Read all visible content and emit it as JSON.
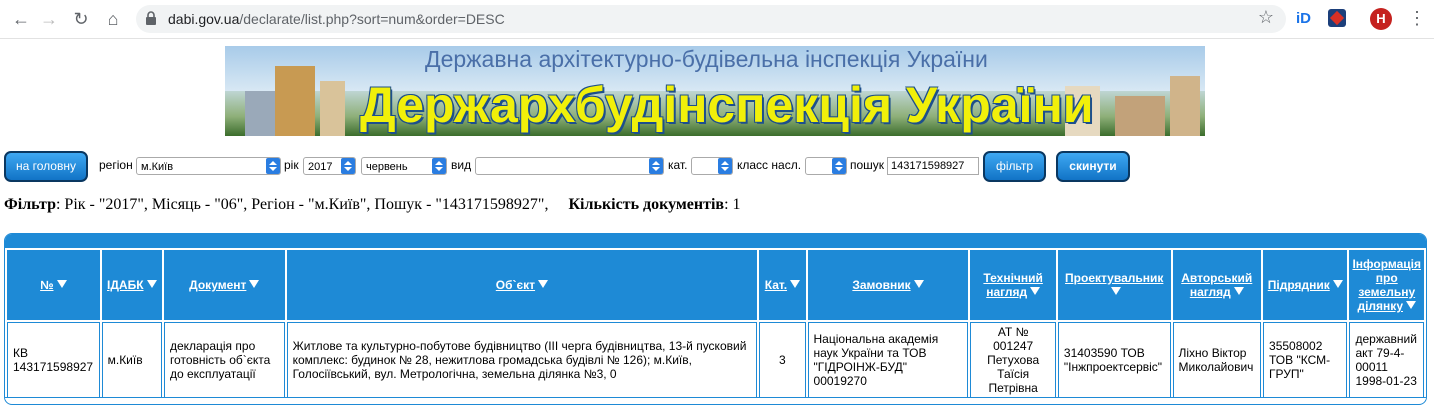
{
  "browser": {
    "url_host": "dabi.gov.ua",
    "url_path": "/declarate/list.php?sort=num&order=DESC",
    "avatar_letter": "H",
    "ext_label": "iD"
  },
  "banner": {
    "subtitle": "Державна архітектурно-будівельна інспекція України",
    "title": "Держархбудінспекція України"
  },
  "controls": {
    "home_button": "на головну",
    "region_label": "регіон",
    "region_value": "м.Київ",
    "year_label": "рік",
    "year_value": "2017",
    "month_value": "червень",
    "type_label": "вид",
    "type_value": "",
    "cat_label": "кат.",
    "cat_value": "",
    "class_label": "класс насл.",
    "class_value": "",
    "search_label": "пошук",
    "search_value": "143171598927",
    "filter_button": "фільтр",
    "reset_button": "скинути"
  },
  "filter_summary": {
    "filter_label": "Фільтр",
    "filter_text": ": Рік - \"2017\", Місяць - \"06\", Регіон - \"м.Київ\", Пошук - \"143171598927\",",
    "count_label": "Кількість документів",
    "count_value": ": 1"
  },
  "table": {
    "headers": [
      "№",
      "ІДАБК",
      "Документ",
      "Об`єкт",
      "Кат.",
      "Замовник",
      "Технічний нагляд",
      "Проектувальник",
      "Авторський нагляд",
      "Підрядник",
      "Інформація про земельну ділянку"
    ],
    "rows": [
      [
        "КВ 143171598927",
        "м.Київ",
        "декларація про готовність об`єкта до експлуатації",
        "Житлове та культурно-побутове будівництво (III черга будівництва, 13-й пусковий комплекс: будинок № 28, нежитлова громадська будівлі № 126); м.Київ, Голосіївський, вул. Метрологічна, земельна ділянка №3, 0",
        "3",
        "Національна академія наук України та ТОВ \"ГІДРОІНЖ-БУД\" 00019270",
        "АТ № 001247 Петухова Таїсія Петрівна",
        "31403590 ТОВ \"Інжпроектсервіс\"",
        "Ліхно Віктор Миколайович",
        "35508002 ТОВ \"КСМ-ГРУП\"",
        "державний акт 79-4-00011 1998-01-23"
      ]
    ]
  }
}
